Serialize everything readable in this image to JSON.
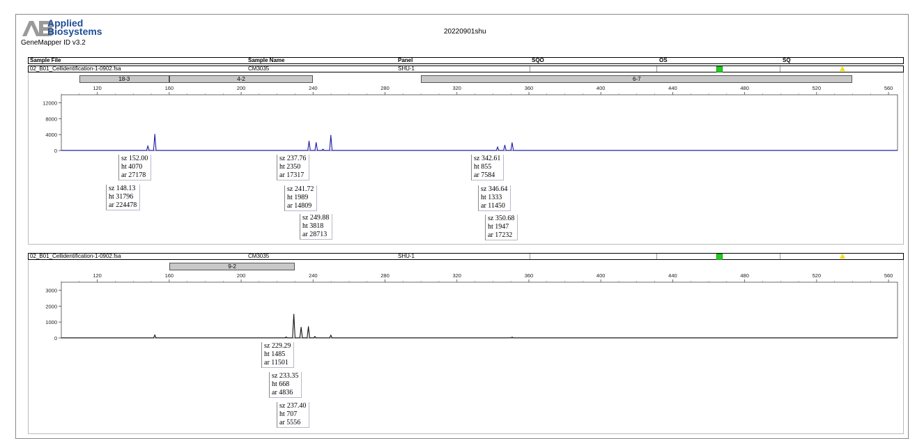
{
  "brand": {
    "line1": "Applied",
    "line2": "Biosystems",
    "logo": "AB"
  },
  "software": "GeneMapper ID v3.2",
  "run_title": "20220901shu",
  "columns": [
    "Sample File",
    "Sample Name",
    "Panel",
    "SQO",
    "OS",
    "SQ"
  ],
  "status_colors": {
    "ok": "#22cc22",
    "check": "#f2e000"
  },
  "chart_data": [
    {
      "type": "line",
      "sample_file": "02_B01_Cellidentification-1-0902.fsa",
      "sample_name": "CM3035",
      "panel": "SHU-1",
      "os_status": "green-square",
      "sq_status": "yellow-triangle",
      "color": "#1a1aa8",
      "xlim": [
        100,
        565
      ],
      "xticks": [
        120,
        160,
        200,
        240,
        280,
        320,
        360,
        400,
        440,
        480,
        520,
        560
      ],
      "ylim": [
        0,
        14000
      ],
      "yticks": [
        0,
        4000,
        8000,
        12000
      ],
      "bins": [
        {
          "label": "18-3",
          "start": 110,
          "end": 160
        },
        {
          "label": "4-2",
          "start": 160,
          "end": 240
        },
        {
          "label": "6-7",
          "start": 300,
          "end": 540
        }
      ],
      "peaks": [
        {
          "x": 148.13,
          "height": 1100
        },
        {
          "x": 152.0,
          "height": 4070
        },
        {
          "x": 237.76,
          "height": 2350
        },
        {
          "x": 241.72,
          "height": 1989
        },
        {
          "x": 245.5,
          "height": 300
        },
        {
          "x": 249.88,
          "height": 3818
        },
        {
          "x": 342.61,
          "height": 855
        },
        {
          "x": 346.64,
          "height": 1333
        },
        {
          "x": 350.68,
          "height": 1947
        }
      ],
      "labels": [
        {
          "sz": "sz 152.00",
          "ht": "ht 4070",
          "ar": "ar 27178"
        },
        {
          "sz": "sz 148.13",
          "ht": "ht 31796",
          "ar": "ar 224478"
        },
        {
          "sz": "sz 237.76",
          "ht": "ht 2350",
          "ar": "ar 17317"
        },
        {
          "sz": "sz 241.72",
          "ht": "ht 1989",
          "ar": "ar 14809"
        },
        {
          "sz": "sz 249.88",
          "ht": "ht 3818",
          "ar": "ar 28713"
        },
        {
          "sz": "sz 342.61",
          "ht": "ht 855",
          "ar": "ar 7584"
        },
        {
          "sz": "sz 346.64",
          "ht": "ht 1333",
          "ar": "ar 11450"
        },
        {
          "sz": "sz 350.68",
          "ht": "ht 1947",
          "ar": "ar 17232"
        }
      ]
    },
    {
      "type": "line",
      "sample_file": "02_B01_Cellidentification-1-0902.fsa",
      "sample_name": "CM3035",
      "panel": "SHU-1",
      "os_status": "green-square",
      "sq_status": "yellow-triangle",
      "color": "#111111",
      "xlim": [
        100,
        565
      ],
      "xticks": [
        120,
        160,
        200,
        240,
        280,
        320,
        360,
        400,
        440,
        480,
        520,
        560
      ],
      "ylim": [
        0,
        3500
      ],
      "yticks": [
        0,
        1000,
        2000,
        3000
      ],
      "bins": [
        {
          "label": "9-2",
          "start": 160,
          "end": 230
        }
      ],
      "peaks": [
        {
          "x": 152.0,
          "height": 180
        },
        {
          "x": 225.0,
          "height": 60
        },
        {
          "x": 229.29,
          "height": 1485
        },
        {
          "x": 233.35,
          "height": 668
        },
        {
          "x": 237.4,
          "height": 707
        },
        {
          "x": 241.0,
          "height": 90
        },
        {
          "x": 249.88,
          "height": 170
        },
        {
          "x": 350.68,
          "height": 50
        }
      ],
      "labels": [
        {
          "sz": "sz 229.29",
          "ht": "ht 1485",
          "ar": "ar 11501"
        },
        {
          "sz": "sz 233.35",
          "ht": "ht 668",
          "ar": "ar 4836"
        },
        {
          "sz": "sz 237.40",
          "ht": "ht 707",
          "ar": "ar 5556"
        }
      ]
    }
  ]
}
